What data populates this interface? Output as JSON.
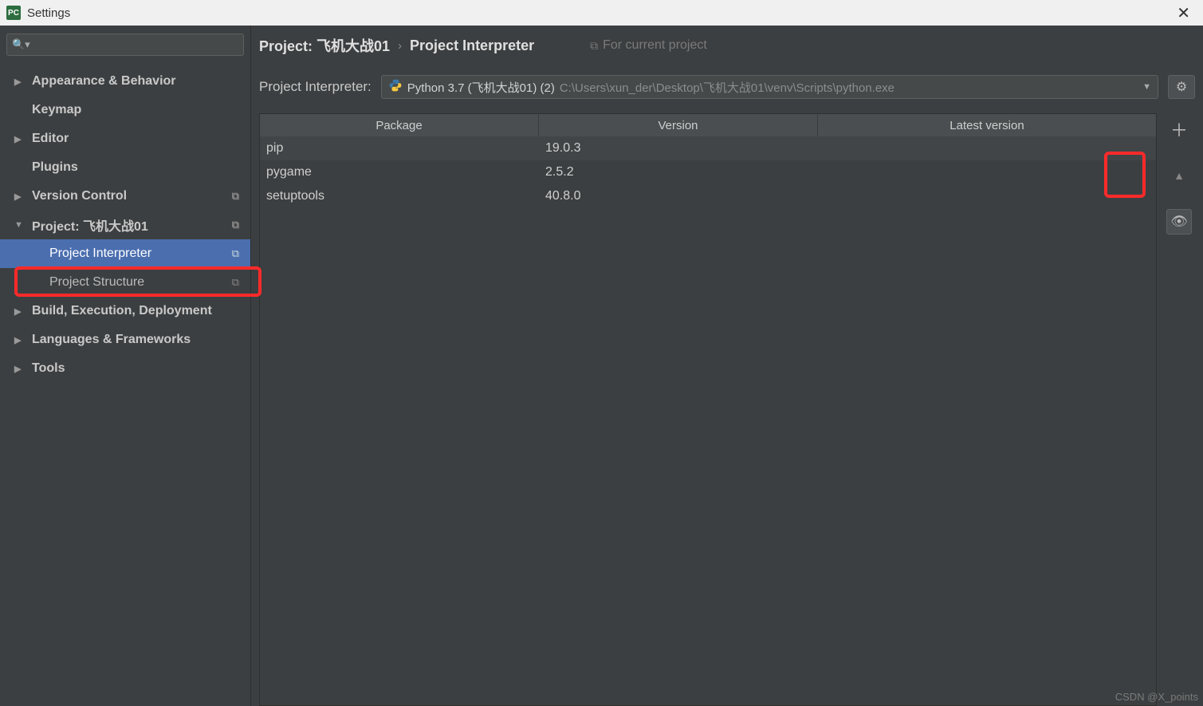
{
  "window": {
    "title": "Settings",
    "app_icon_label": "PC"
  },
  "sidebar": {
    "search_placeholder": "",
    "items": [
      {
        "label": "Appearance & Behavior",
        "expandable": true
      },
      {
        "label": "Keymap",
        "expandable": false
      },
      {
        "label": "Editor",
        "expandable": true
      },
      {
        "label": "Plugins",
        "expandable": false
      },
      {
        "label": "Version Control",
        "expandable": true,
        "copy": true
      },
      {
        "label": "Project: 飞机大战01",
        "expandable": true,
        "expanded": true,
        "copy": true,
        "children": [
          {
            "label": "Project Interpreter",
            "copy": true,
            "selected": true
          },
          {
            "label": "Project Structure",
            "copy": true
          }
        ]
      },
      {
        "label": "Build, Execution, Deployment",
        "expandable": true
      },
      {
        "label": "Languages & Frameworks",
        "expandable": true
      },
      {
        "label": "Tools",
        "expandable": true
      }
    ]
  },
  "breadcrumb": {
    "a": "Project: 飞机大战01",
    "b": "Project Interpreter",
    "hint": "For current project"
  },
  "interpreter": {
    "label": "Project Interpreter:",
    "name": "Python 3.7 (飞机大战01) (2)",
    "path": "C:\\Users\\xun_der\\Desktop\\飞机大战01\\venv\\Scripts\\python.exe"
  },
  "packages": {
    "headers": {
      "package": "Package",
      "version": "Version",
      "latest": "Latest version"
    },
    "rows": [
      {
        "name": "pip",
        "version": "19.0.3",
        "latest": ""
      },
      {
        "name": "pygame",
        "version": "2.5.2",
        "latest": ""
      },
      {
        "name": "setuptools",
        "version": "40.8.0",
        "latest": ""
      }
    ]
  },
  "watermark": "CSDN @X_points"
}
